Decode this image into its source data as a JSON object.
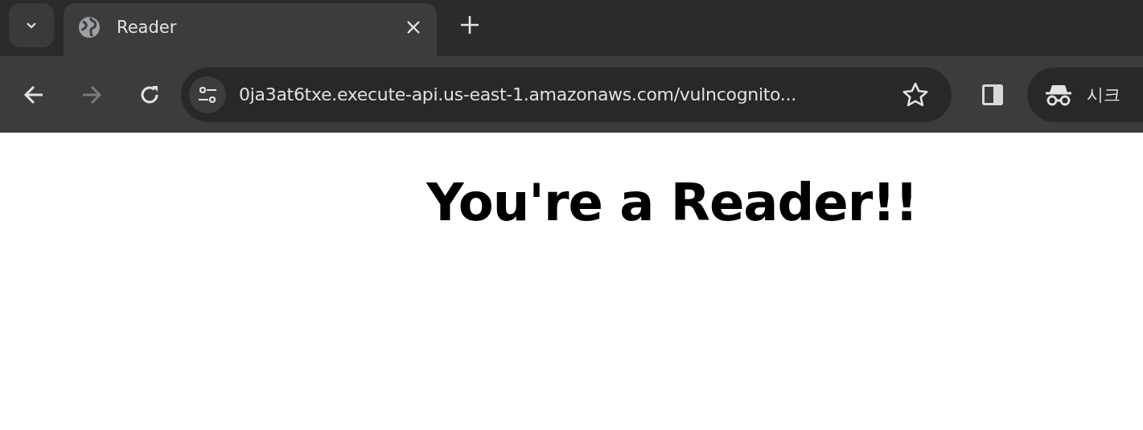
{
  "tabs": [
    {
      "title": "Reader",
      "selected": true
    }
  ],
  "toolbar": {
    "back": {
      "disabled": false
    },
    "forward": {
      "disabled": true
    },
    "address": {
      "value": "0ja3at6txe.execute-api.us-east-1.amazonaws.com/vulncognito..."
    },
    "bookmarked": false,
    "profile_badge": "시크"
  },
  "page": {
    "heading": "You're a Reader!!"
  }
}
